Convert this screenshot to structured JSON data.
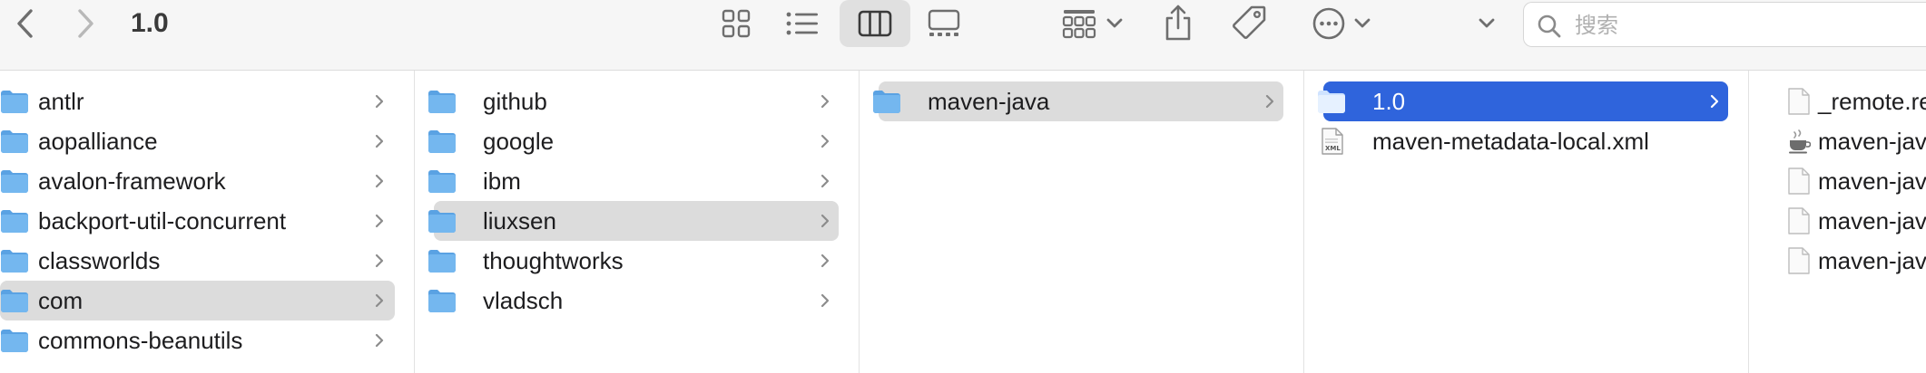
{
  "window": {
    "title": "1.0"
  },
  "search": {
    "placeholder": "搜索"
  },
  "colors": {
    "folder": "#74b7ef",
    "folder_dark": "#5aa2e3",
    "selection_active": "#2f64dc",
    "selection_inactive": "#dcdcdc"
  },
  "columns": [
    {
      "items": [
        {
          "name": "antlr",
          "kind": "folder",
          "chevron": true,
          "state": "normal"
        },
        {
          "name": "aopalliance",
          "kind": "folder",
          "chevron": true,
          "state": "normal"
        },
        {
          "name": "avalon-framework",
          "kind": "folder",
          "chevron": true,
          "state": "normal"
        },
        {
          "name": "backport-util-concurrent",
          "kind": "folder",
          "chevron": true,
          "state": "normal"
        },
        {
          "name": "classworlds",
          "kind": "folder",
          "chevron": true,
          "state": "normal"
        },
        {
          "name": "com",
          "kind": "folder",
          "chevron": true,
          "state": "selected-inactive"
        },
        {
          "name": "commons-beanutils",
          "kind": "folder",
          "chevron": true,
          "state": "normal"
        }
      ]
    },
    {
      "items": [
        {
          "name": "github",
          "kind": "folder",
          "chevron": true,
          "state": "normal"
        },
        {
          "name": "google",
          "kind": "folder",
          "chevron": true,
          "state": "normal"
        },
        {
          "name": "ibm",
          "kind": "folder",
          "chevron": true,
          "state": "normal"
        },
        {
          "name": "liuxsen",
          "kind": "folder",
          "chevron": true,
          "state": "selected-inactive"
        },
        {
          "name": "thoughtworks",
          "kind": "folder",
          "chevron": true,
          "state": "normal"
        },
        {
          "name": "vladsch",
          "kind": "folder",
          "chevron": true,
          "state": "normal"
        }
      ]
    },
    {
      "items": [
        {
          "name": "maven-java",
          "kind": "folder",
          "chevron": true,
          "state": "selected-inactive"
        }
      ]
    },
    {
      "items": [
        {
          "name": "1.0",
          "kind": "folder",
          "chevron": true,
          "state": "selected-active"
        },
        {
          "name": "maven-metadata-local.xml",
          "kind": "xml-file",
          "chevron": false,
          "state": "normal",
          "badge": "XML"
        }
      ]
    },
    {
      "items": [
        {
          "name": "_remote.re",
          "kind": "file",
          "chevron": false,
          "state": "normal"
        },
        {
          "name": "maven-jav",
          "kind": "java-file",
          "chevron": false,
          "state": "normal"
        },
        {
          "name": "maven-jav",
          "kind": "file",
          "chevron": false,
          "state": "normal"
        },
        {
          "name": "maven-jav",
          "kind": "file",
          "chevron": false,
          "state": "normal"
        },
        {
          "name": "maven-jav",
          "kind": "file",
          "chevron": false,
          "state": "normal"
        }
      ]
    }
  ]
}
